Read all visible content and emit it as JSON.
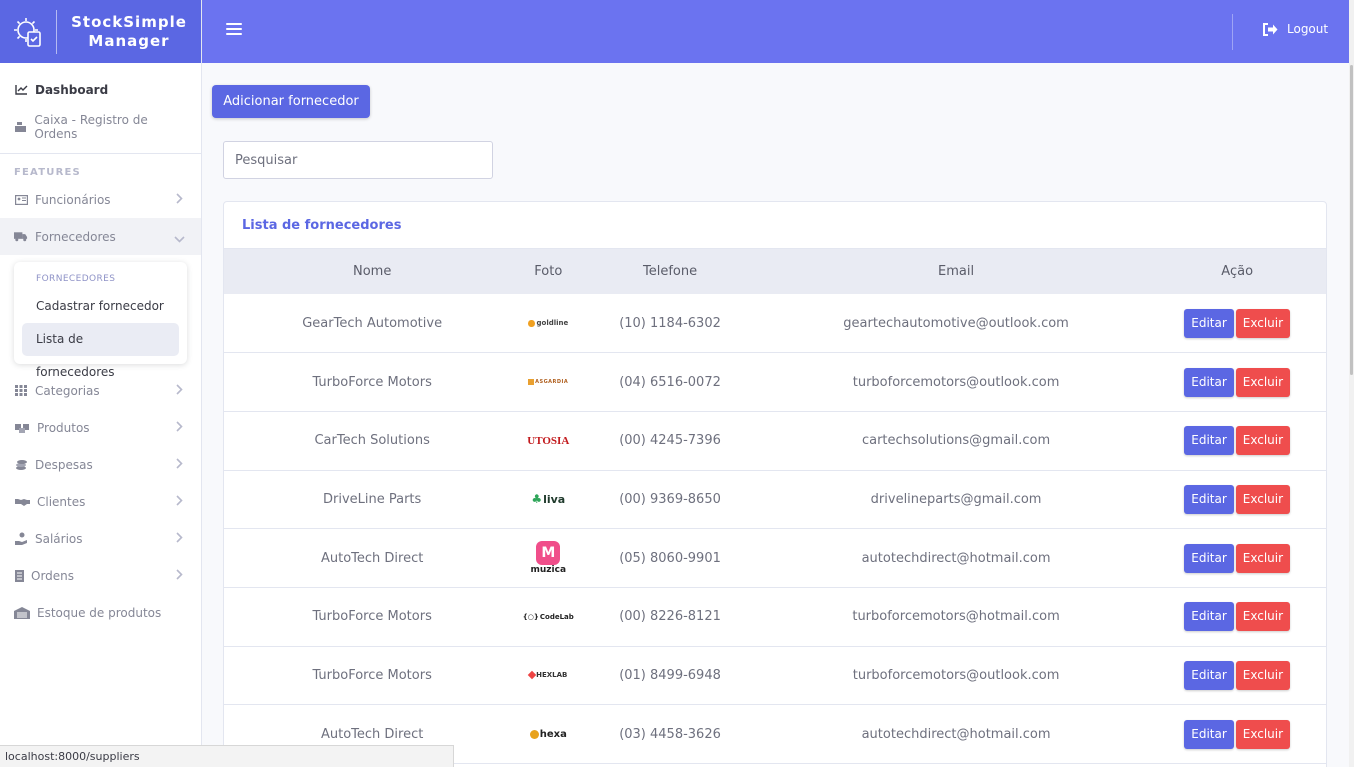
{
  "brand": {
    "title": "StockSimple Manager",
    "line1": "StockSimple",
    "line2": "Manager"
  },
  "topbar": {
    "logout_label": "Logout"
  },
  "sidebar": {
    "top_items": [
      {
        "label": "Dashboard",
        "icon": "chart-line-icon"
      },
      {
        "label": "Caixa - Registro de Ordens",
        "icon": "cash-register-icon"
      }
    ],
    "features_heading": "FEATURES",
    "items": [
      {
        "label": "Funcionários",
        "icon": "id-card-icon"
      },
      {
        "label": "Fornecedores",
        "icon": "truck-icon",
        "open": true
      },
      {
        "label": "Categorias",
        "icon": "grid-icon"
      },
      {
        "label": "Produtos",
        "icon": "boxes-icon"
      },
      {
        "label": "Despesas",
        "icon": "coins-icon"
      },
      {
        "label": "Clientes",
        "icon": "handshake-icon"
      },
      {
        "label": "Salários",
        "icon": "hand-money-icon"
      },
      {
        "label": "Ordens",
        "icon": "receipt-icon"
      },
      {
        "label": "Estoque de produtos",
        "icon": "warehouse-icon"
      }
    ],
    "submenu": {
      "heading": "FORNECEDORES",
      "items": [
        "Cadastrar fornecedor",
        "Lista de fornecedores"
      ],
      "selected": "Lista de fornecedores"
    }
  },
  "main": {
    "add_button": "Adicionar fornecedor",
    "search_placeholder": "Pesquisar",
    "card_title": "Lista de fornecedores",
    "columns": [
      "Nome",
      "Foto",
      "Telefone",
      "Email",
      "Ação"
    ],
    "edit_label": "Editar",
    "delete_label": "Excluir",
    "rows": [
      {
        "nome": "GearTech Automotive",
        "logo": "goldline",
        "telefone": "(10) 1184-6302",
        "email": "geartechautomotive@outlook.com"
      },
      {
        "nome": "TurboForce Motors",
        "logo": "ASGARDIA",
        "telefone": "(04) 6516-0072",
        "email": "turboforcemotors@outlook.com"
      },
      {
        "nome": "CarTech Solutions",
        "logo": "UTOSIA",
        "telefone": "(00) 4245-7396",
        "email": "cartechsolutions@gmail.com"
      },
      {
        "nome": "DriveLine Parts",
        "logo": "liva",
        "telefone": "(00) 9369-8650",
        "email": "drivelineparts@gmail.com"
      },
      {
        "nome": "AutoTech Direct",
        "logo": "muzica",
        "telefone": "(05) 8060-9901",
        "email": "autotechdirect@hotmail.com"
      },
      {
        "nome": "TurboForce Motors",
        "logo": "CodeLab",
        "telefone": "(00) 8226-8121",
        "email": "turboforcemotors@hotmail.com"
      },
      {
        "nome": "TurboForce Motors",
        "logo": "HEXLAB",
        "telefone": "(01) 8499-6948",
        "email": "turboforcemotors@outlook.com"
      },
      {
        "nome": "AutoTech Direct",
        "logo": "hexa",
        "telefone": "(03) 4458-3626",
        "email": "autotechdirect@hotmail.com"
      }
    ]
  },
  "statusbar": {
    "url": "localhost:8000/suppliers"
  },
  "colors": {
    "primary": "#5b67e3",
    "topbar": "#6b73f0",
    "danger": "#ef4d4d"
  }
}
